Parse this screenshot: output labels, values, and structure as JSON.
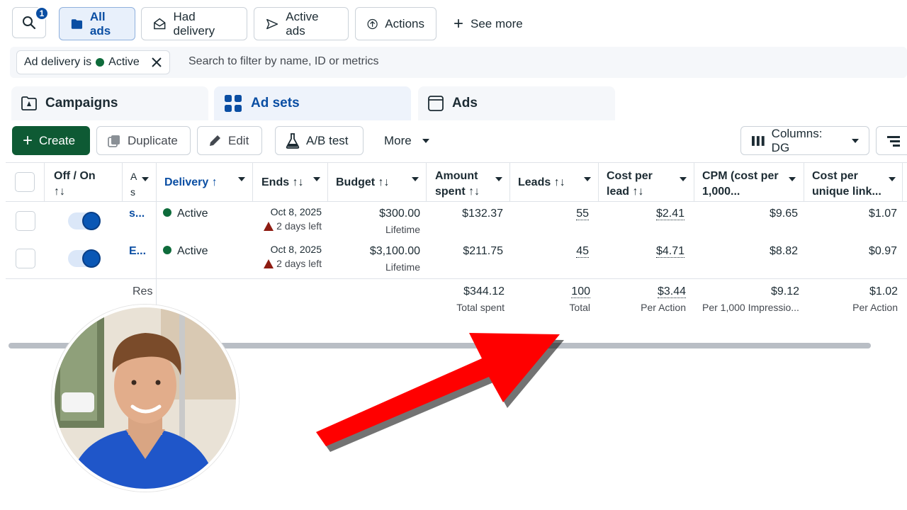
{
  "topbar": {
    "search_badge": "1",
    "chips": {
      "all_ads": "All ads",
      "had_delivery": "Had delivery",
      "active_ads": "Active ads",
      "actions": "Actions",
      "see_more": "See more"
    }
  },
  "filter": {
    "pill_prefix": "Ad delivery is",
    "pill_value": "Active",
    "search_placeholder": "Search to filter by name, ID or metrics"
  },
  "tabs": {
    "campaigns": "Campaigns",
    "ad_sets": "Ad sets",
    "ads": "Ads"
  },
  "toolbar": {
    "create": "Create",
    "duplicate": "Duplicate",
    "edit": "Edit",
    "ab_test": "A/B test",
    "more": "More",
    "columns": "Columns: DG"
  },
  "table": {
    "headers": {
      "off_on_1": "Off / On",
      "off_on_2": "↑↓",
      "name_1": "A",
      "name_2": "s",
      "delivery": "Delivery ↑",
      "ends": "Ends ↑↓",
      "budget": "Budget ↑↓",
      "amount_1": "Amount",
      "amount_2": "spent ↑↓",
      "leads": "Leads ↑↓",
      "cpl_1": "Cost per",
      "cpl_2": "lead ↑↓",
      "cpm_1": "CPM (cost per",
      "cpm_2": "1,000...",
      "cpu_1": "Cost per",
      "cpu_2": "unique link..."
    },
    "rows": [
      {
        "name": "s...",
        "delivery": "Active",
        "ends_date": "Oct 8, 2025",
        "ends_note": "2 days left",
        "budget": "$300.00",
        "budget_type": "Lifetime",
        "amount": "$132.37",
        "leads": "55",
        "cpl": "$2.41",
        "cpm": "$9.65",
        "cpu": "$1.07"
      },
      {
        "name": "E...",
        "delivery": "Active",
        "ends_date": "Oct 8, 2025",
        "ends_note": "2 days left",
        "budget": "$3,100.00",
        "budget_type": "Lifetime",
        "amount": "$211.75",
        "leads": "45",
        "cpl": "$4.71",
        "cpm": "$8.82",
        "cpu": "$0.97"
      }
    ],
    "totals": {
      "label": "Res",
      "amount": "$344.12",
      "amount_sub": "Total spent",
      "leads": "100",
      "leads_sub": "Total",
      "cpl": "$3.44",
      "cpl_sub": "Per Action",
      "cpm": "$9.12",
      "cpm_sub": "Per 1,000 Impressio...",
      "cpu": "$1.02",
      "cpu_sub": "Per Action"
    }
  },
  "colors": {
    "accent": "#0a4ea3",
    "create_green": "#0e5a34",
    "active_dot": "#0e6b3b",
    "arrow_red": "#ff0000"
  }
}
